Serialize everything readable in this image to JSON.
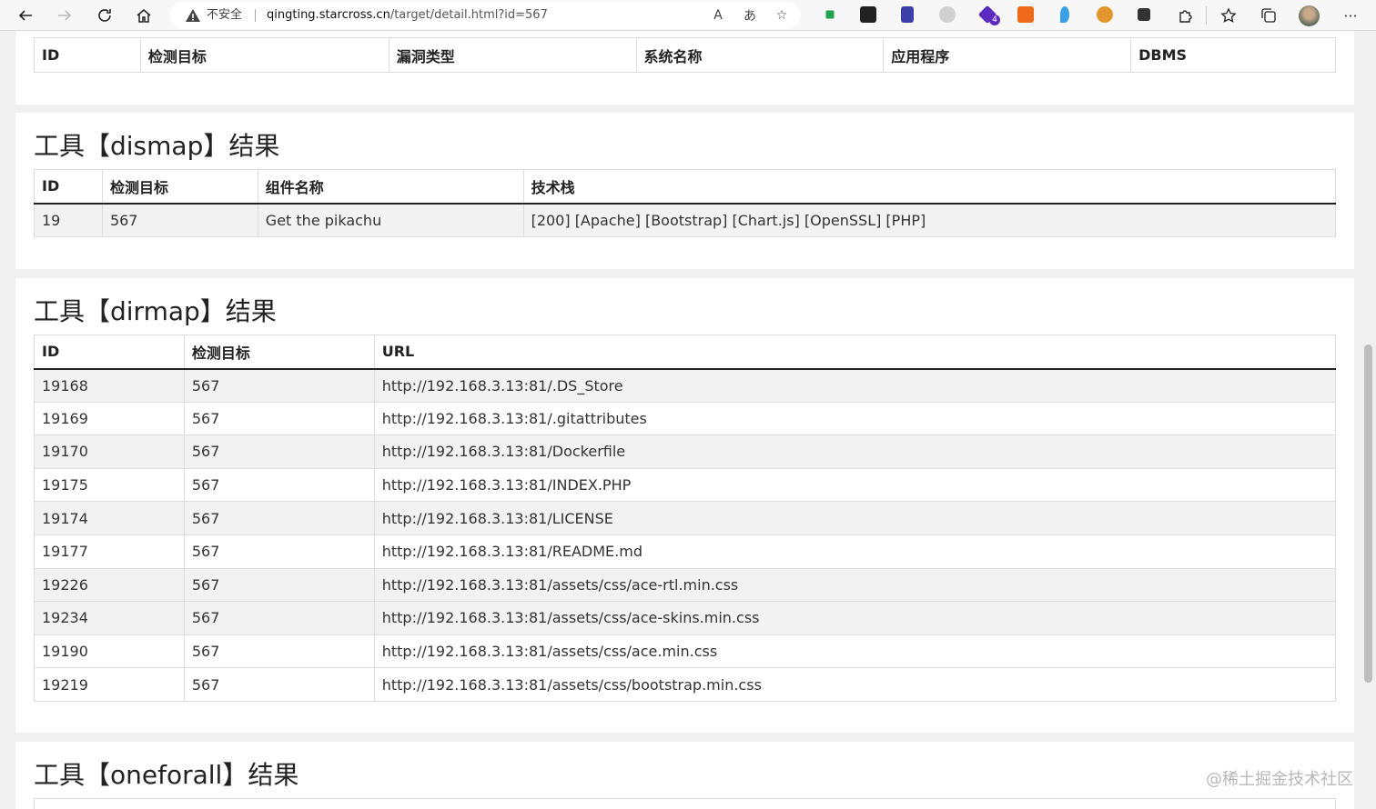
{
  "browser": {
    "security_label": "不安全",
    "url_host": "qingting.starcross.cn",
    "url_path": "/target/detail.html?id=567",
    "read_aloud_icon": "A",
    "translate_icon": "あ",
    "ext_badge": "4"
  },
  "table_top": {
    "headers": [
      "ID",
      "检测目标",
      "漏洞类型",
      "系统名称",
      "应用程序",
      "DBMS"
    ]
  },
  "dismap": {
    "title": "工具【dismap】结果",
    "headers": [
      "ID",
      "检测目标",
      "组件名称",
      "技术栈"
    ],
    "row": {
      "id": "19",
      "target": "567",
      "component": "Get the pikachu",
      "stack": "[200] [Apache] [Bootstrap] [Chart.js] [OpenSSL] [PHP]"
    }
  },
  "dirmap": {
    "title": "工具【dirmap】结果",
    "headers": [
      "ID",
      "检测目标",
      "URL"
    ],
    "rows": [
      {
        "id": "19168",
        "target": "567",
        "url": "http://192.168.3.13:81/.DS_Store"
      },
      {
        "id": "19169",
        "target": "567",
        "url": "http://192.168.3.13:81/.gitattributes"
      },
      {
        "id": "19170",
        "target": "567",
        "url": "http://192.168.3.13:81/Dockerfile"
      },
      {
        "id": "19175",
        "target": "567",
        "url": "http://192.168.3.13:81/INDEX.PHP"
      },
      {
        "id": "19174",
        "target": "567",
        "url": "http://192.168.3.13:81/LICENSE"
      },
      {
        "id": "19177",
        "target": "567",
        "url": "http://192.168.3.13:81/README.md"
      },
      {
        "id": "19226",
        "target": "567",
        "url": "http://192.168.3.13:81/assets/css/ace-rtl.min.css"
      },
      {
        "id": "19234",
        "target": "567",
        "url": "http://192.168.3.13:81/assets/css/ace-skins.min.css"
      },
      {
        "id": "19190",
        "target": "567",
        "url": "http://192.168.3.13:81/assets/css/ace.min.css"
      },
      {
        "id": "19219",
        "target": "567",
        "url": "http://192.168.3.13:81/assets/css/bootstrap.min.css"
      }
    ]
  },
  "oneforall": {
    "title": "工具【oneforall】结果"
  },
  "watermark": "@稀土掘金技术社区",
  "colors": {
    "page_bg": "#f0f0f0",
    "panel_bg": "#ffffff",
    "stripe": "#f2f2f2"
  }
}
